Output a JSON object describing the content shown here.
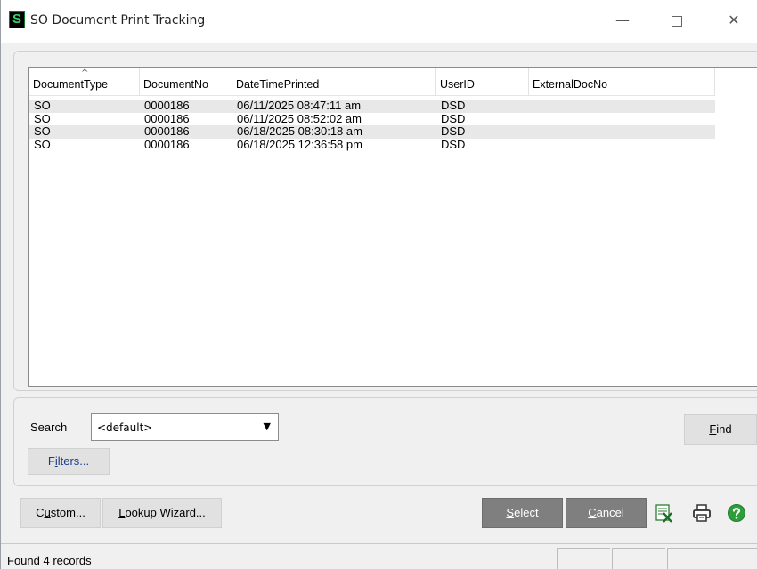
{
  "window": {
    "title": "SO Document Print Tracking",
    "icon_letter": "S",
    "minimize_glyph": "—",
    "close_glyph": "✕"
  },
  "grid": {
    "sort_indicator": "^",
    "columns": [
      "DocumentType",
      "DocumentNo",
      "DateTimePrinted",
      "UserID",
      "ExternalDocNo"
    ],
    "rows": [
      [
        "SO",
        "0000186",
        "06/11/2025 08:47:11 am",
        "DSD",
        ""
      ],
      [
        "SO",
        "0000186",
        "06/11/2025 08:52:02 am",
        "DSD",
        ""
      ],
      [
        "SO",
        "0000186",
        "06/18/2025 08:30:18 am",
        "DSD",
        ""
      ],
      [
        "SO",
        "0000186",
        "06/18/2025 12:36:58 pm",
        "DSD",
        ""
      ]
    ]
  },
  "search": {
    "label": "Search",
    "value": "<default>",
    "arrow": "▼",
    "filters_label": {
      "pre": "F",
      "key": "i",
      "post": "lters..."
    },
    "find_label": {
      "pre": "",
      "key": "F",
      "post": "ind"
    }
  },
  "buttons": {
    "custom": {
      "pre": "C",
      "key": "u",
      "post": "stom..."
    },
    "lookup": {
      "pre": "",
      "key": "L",
      "post": "ookup Wizard..."
    },
    "select": {
      "pre": "",
      "key": "S",
      "post": "elect"
    },
    "cancel": {
      "pre": "",
      "key": "C",
      "post": "ancel"
    }
  },
  "icons": [
    "excel-export-icon",
    "printer-icon",
    "help-icon"
  ],
  "colors": {
    "accent_green": "#35d16a",
    "button_dark": "#7f7f7f",
    "help_green": "#2e9e3c"
  },
  "status": {
    "text": "Found 4 records"
  }
}
